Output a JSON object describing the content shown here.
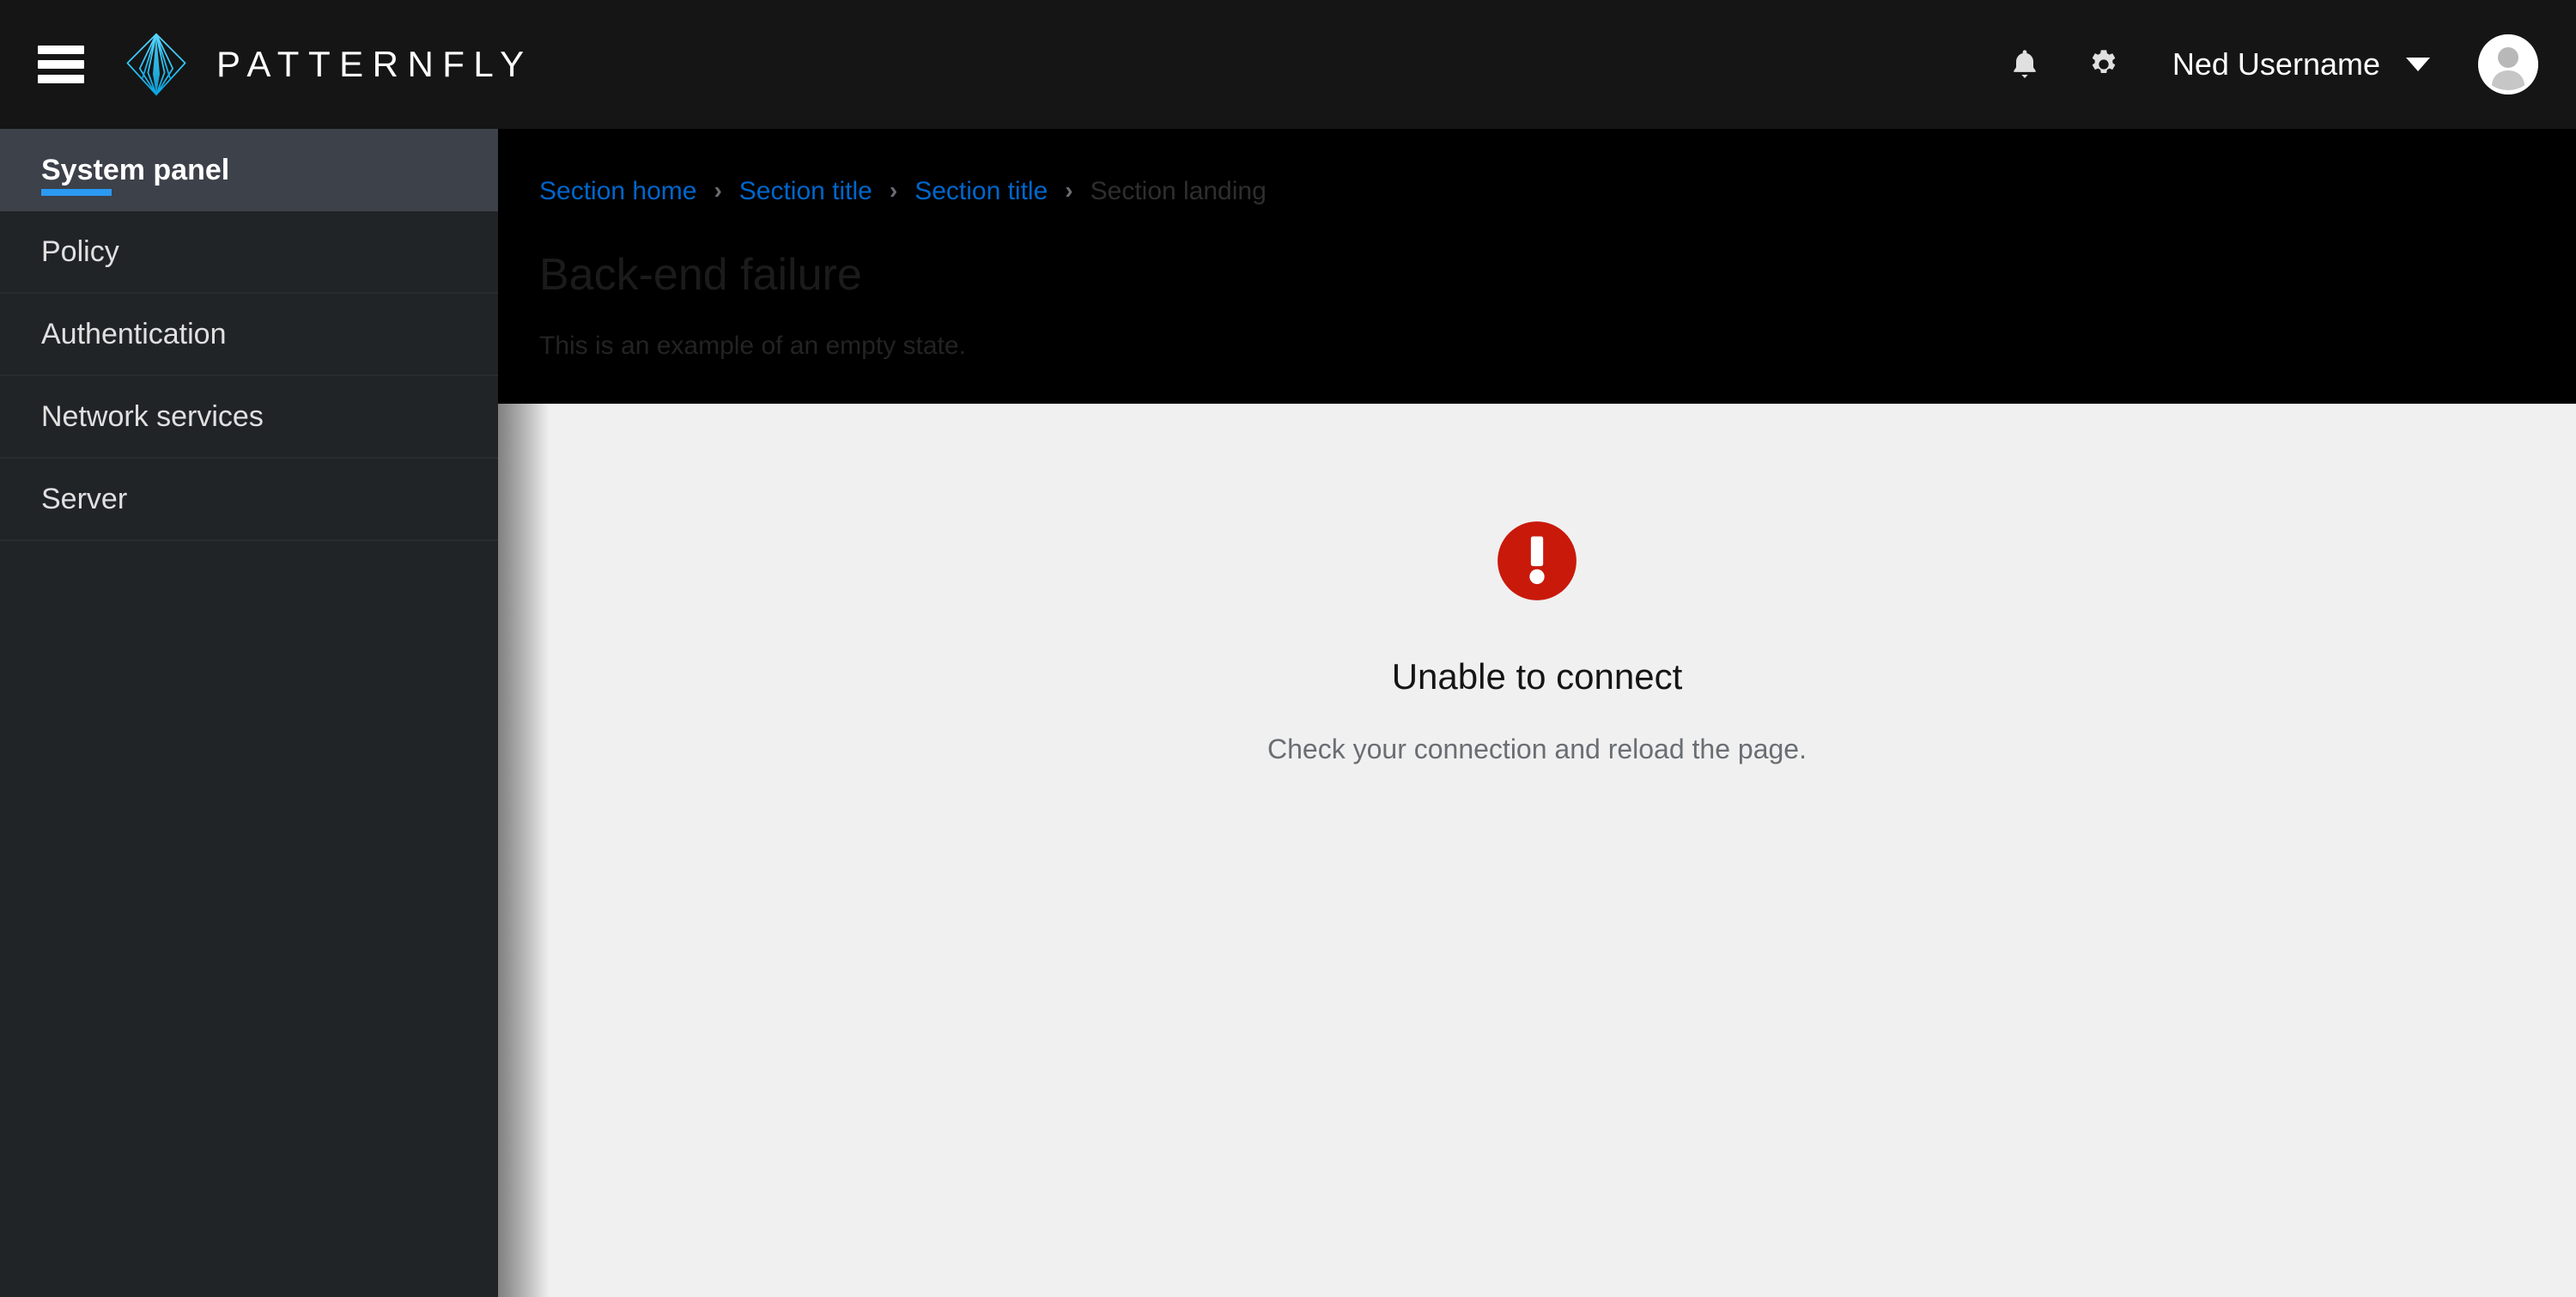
{
  "masthead": {
    "toggle_label": "Global navigation",
    "brand_name": "PATTERNFLY",
    "notifications_label": "Notifications",
    "settings_label": "Settings",
    "user_name": "Ned Username",
    "avatar_label": "User avatar"
  },
  "sidebar": {
    "items": [
      {
        "label": "System panel",
        "active": true
      },
      {
        "label": "Policy",
        "active": false
      },
      {
        "label": "Authentication",
        "active": false
      },
      {
        "label": "Network services",
        "active": false
      },
      {
        "label": "Server",
        "active": false
      }
    ]
  },
  "breadcrumb": {
    "separator": "›",
    "items": [
      {
        "label": "Section home",
        "current": false
      },
      {
        "label": "Section title",
        "current": false
      },
      {
        "label": "Section title",
        "current": false
      },
      {
        "label": "Section landing",
        "current": true
      }
    ]
  },
  "page": {
    "title": "Back-end failure",
    "subtitle": "This is an example of an empty state."
  },
  "empty_state": {
    "icon": "exclamation-circle-icon",
    "title": "Unable to connect",
    "body": "Check your connection and reload the page."
  },
  "colors": {
    "masthead_bg": "#151515",
    "sidebar_bg": "#212427",
    "sidebar_active_bg": "#3c414a",
    "accent_blue": "#2b9af3",
    "link_blue": "#0066cc",
    "danger_red": "#c9190b",
    "content_bg": "#f0f0f0",
    "header_bg": "#000000"
  }
}
